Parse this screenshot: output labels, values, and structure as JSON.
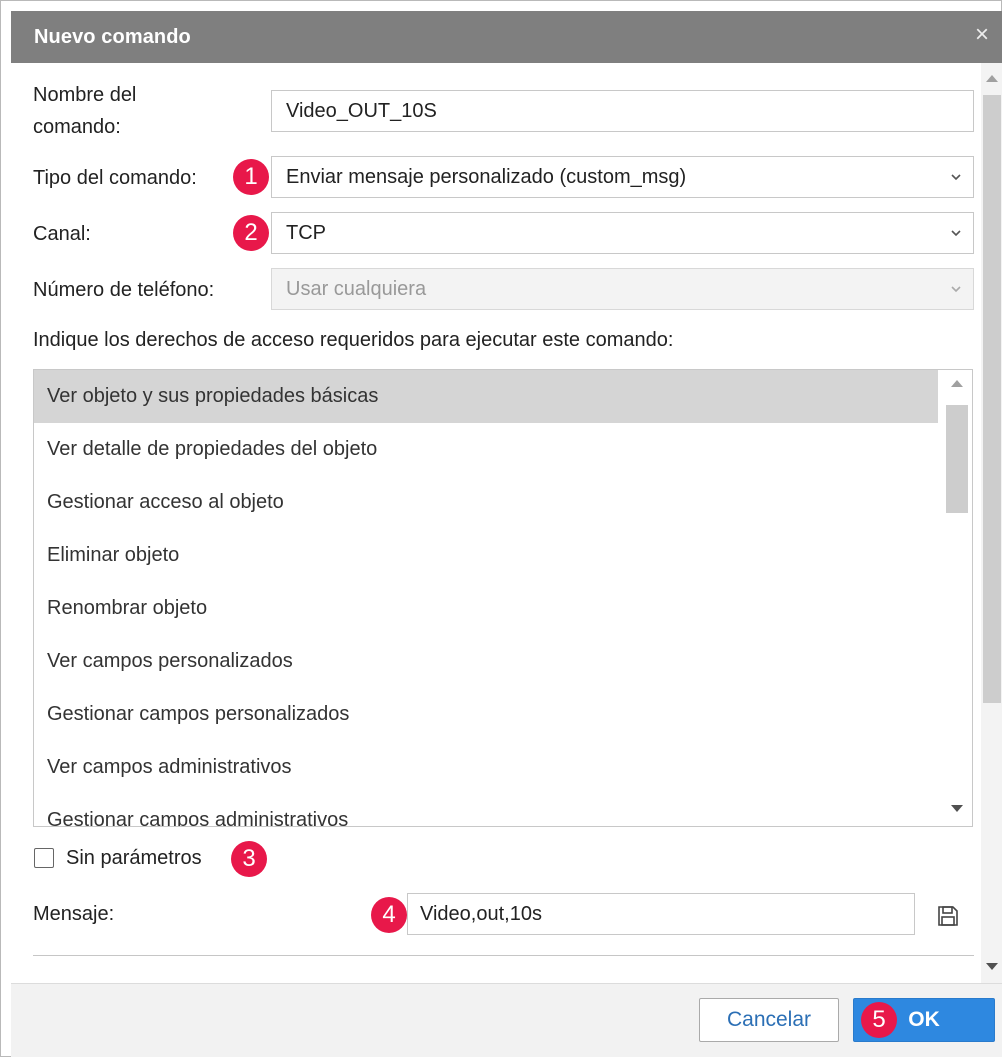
{
  "dialog": {
    "title": "Nuevo comando",
    "close_icon": "×"
  },
  "form": {
    "name_label": "Nombre del\ncomando:",
    "name_value": "Video_OUT_10S",
    "type_label": "Tipo del comando:",
    "type_value": "Enviar mensaje personalizado (custom_msg)",
    "channel_label": "Canal:",
    "channel_value": "TCP",
    "phone_label": "Número de teléfono:",
    "phone_value": "Usar cualquiera",
    "access_label": "Indique los derechos de acceso requeridos para ejecutar este comando:",
    "no_params_label": "Sin parámetros",
    "message_label": "Mensaje:",
    "message_value": "Video,out,10s"
  },
  "access_rights": [
    "Ver objeto y sus propiedades básicas",
    "Ver detalle de propiedades del objeto",
    "Gestionar acceso al objeto",
    "Eliminar objeto",
    "Renombrar objeto",
    "Ver campos personalizados",
    "Gestionar campos personalizados",
    "Ver campos administrativos",
    "Gestionar campos administrativos"
  ],
  "badges": [
    "1",
    "2",
    "3",
    "4",
    "5"
  ],
  "buttons": {
    "cancel": "Cancelar",
    "ok": "OK"
  },
  "colors": {
    "badge": "#e8184a",
    "titlebar": "#7f7f7f",
    "ok_button": "#2e88e0",
    "cancel_text": "#2b6fb5"
  },
  "icons": {
    "close": "close-icon",
    "chevron": "chevron-down-icon",
    "save": "save-icon"
  }
}
